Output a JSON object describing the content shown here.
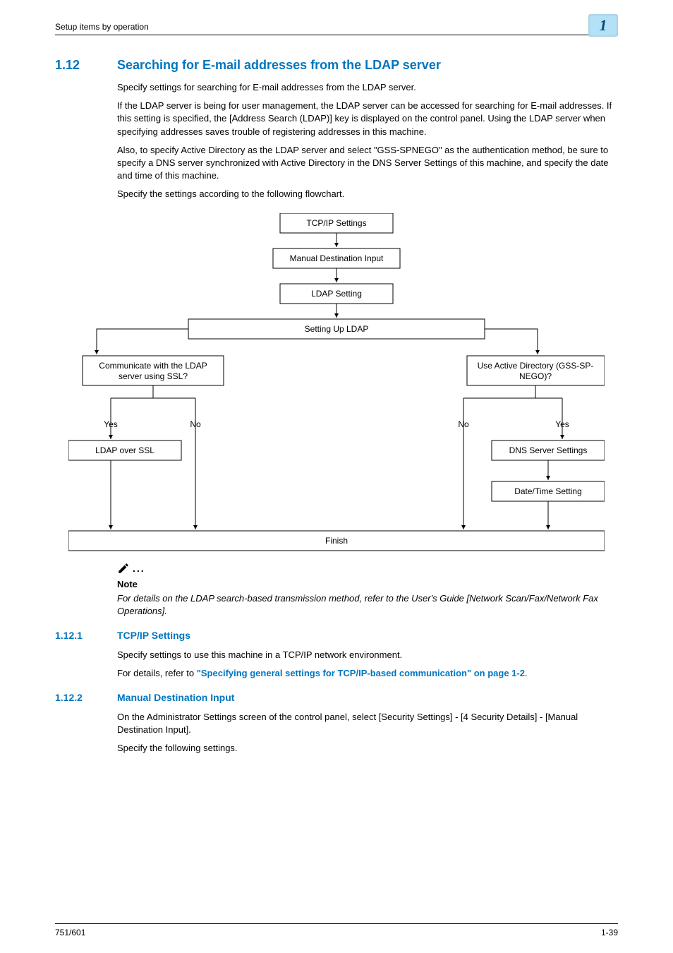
{
  "header": {
    "left": "Setup items by operation",
    "chapter": "1"
  },
  "h1": {
    "num": "1.12",
    "title": "Searching for E-mail addresses from the LDAP server"
  },
  "intro": {
    "p1": "Specify settings for searching for E-mail addresses from the LDAP server.",
    "p2": "If the LDAP server is being for user management, the LDAP server can be accessed for searching for E-mail addresses. If this setting is specified, the [Address Search (LDAP)] key is displayed on the control panel. Using the LDAP server when specifying addresses saves trouble of registering addresses in this machine.",
    "p3": "Also, to specify Active Directory as the LDAP server and select \"GSS-SPNEGO\" as the authentication method, be sure to specify a DNS server synchronized with Active Directory in the DNS Server Settings of this machine, and specify the date and time of this machine.",
    "p4": "Specify the settings according to the following flowchart."
  },
  "flow": {
    "b1": "TCP/IP Settings",
    "b2": "Manual Destination Input",
    "b3": "LDAP Setting",
    "b4": "Setting Up LDAP",
    "q1a": "Communicate with the LDAP",
    "q1b": "server using SSL?",
    "q2a": "Use Active Directory (GSS-SP-",
    "q2b": "NEGO)?",
    "yes": "Yes",
    "no": "No",
    "b5": "LDAP over SSL",
    "b6": "DNS Server Settings",
    "b7": "Date/Time Setting",
    "b8": "Finish"
  },
  "note": {
    "dots": "...",
    "label": "Note",
    "text": "For details on the LDAP search-based transmission method, refer to the User's Guide [Network Scan/Fax/Network Fax Operations]."
  },
  "s1": {
    "num": "1.12.1",
    "title": "TCP/IP Settings",
    "p1": "Specify settings to use this machine in a TCP/IP network environment.",
    "p2a": "For details, refer to ",
    "link": "\"Specifying general settings for TCP/IP-based communication\" on page 1-2",
    "p2b": "."
  },
  "s2": {
    "num": "1.12.2",
    "title": "Manual Destination Input",
    "p1": "On the Administrator Settings screen of the control panel, select [Security Settings] - [4 Security Details] - [Manual Destination Input].",
    "p2": "Specify the following settings."
  },
  "footer": {
    "left": "751/601",
    "right": "1-39"
  },
  "chart_data": {
    "type": "flowchart",
    "nodes": [
      {
        "id": "n1",
        "label": "TCP/IP Settings"
      },
      {
        "id": "n2",
        "label": "Manual Destination Input"
      },
      {
        "id": "n3",
        "label": "LDAP Setting"
      },
      {
        "id": "n4",
        "label": "Setting Up LDAP"
      },
      {
        "id": "q1",
        "label": "Communicate with the LDAP server using SSL?",
        "type": "decision"
      },
      {
        "id": "q2",
        "label": "Use Active Directory (GSS-SPNEGO)?",
        "type": "decision"
      },
      {
        "id": "n5",
        "label": "LDAP over SSL"
      },
      {
        "id": "n6",
        "label": "DNS Server Settings"
      },
      {
        "id": "n7",
        "label": "Date/Time Setting"
      },
      {
        "id": "n8",
        "label": "Finish"
      }
    ],
    "edges": [
      {
        "from": "n1",
        "to": "n2"
      },
      {
        "from": "n2",
        "to": "n3"
      },
      {
        "from": "n3",
        "to": "n4"
      },
      {
        "from": "n4",
        "to": "q1"
      },
      {
        "from": "n4",
        "to": "q2"
      },
      {
        "from": "q1",
        "to": "n5",
        "label": "Yes"
      },
      {
        "from": "q1",
        "to": "n8",
        "label": "No"
      },
      {
        "from": "q2",
        "to": "n6",
        "label": "Yes"
      },
      {
        "from": "q2",
        "to": "n8",
        "label": "No"
      },
      {
        "from": "n5",
        "to": "n8"
      },
      {
        "from": "n6",
        "to": "n7"
      },
      {
        "from": "n7",
        "to": "n8"
      }
    ]
  }
}
